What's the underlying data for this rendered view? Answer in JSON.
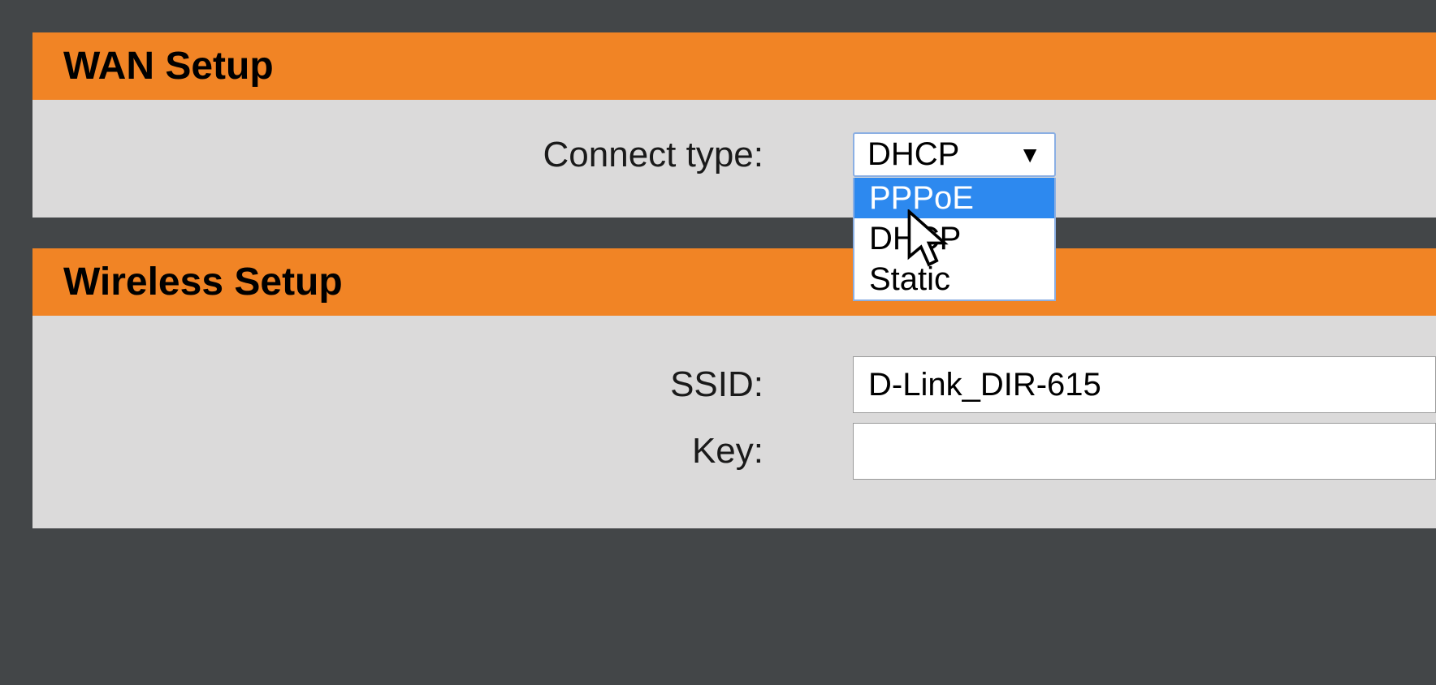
{
  "wan": {
    "title": "WAN Setup",
    "connect_type_label": "Connect type:",
    "connect_type_value": "DHCP",
    "connect_type_options": [
      "PPPoE",
      "DHCP",
      "Static"
    ]
  },
  "wireless": {
    "title": "Wireless Setup",
    "ssid_label": "SSID:",
    "ssid_value": "D-Link_DIR-615",
    "key_label": "Key:",
    "key_value": ""
  }
}
